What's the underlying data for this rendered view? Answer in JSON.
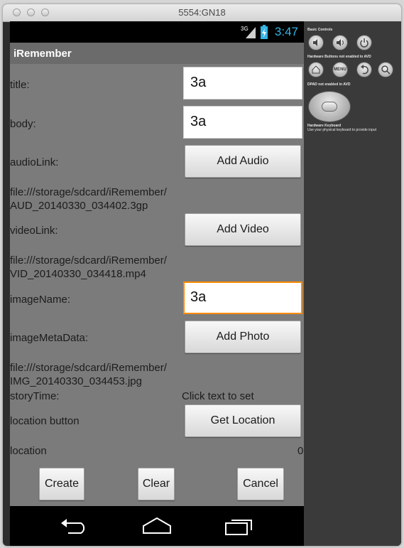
{
  "window": {
    "title": "5554:GN18"
  },
  "status_bar": {
    "network": "3G",
    "time": "3:47"
  },
  "app": {
    "title": "iRemember"
  },
  "form": {
    "title_label": "title:",
    "title_value": "3a",
    "body_label": "body:",
    "body_value": "3a",
    "audio_label": "audioLink:",
    "audio_button": "Add Audio",
    "audio_path_line1": "file:///storage/sdcard/iRemember/",
    "audio_path_line2": "AUD_20140330_034402.3gp",
    "video_label": "videoLink:",
    "video_button": "Add Video",
    "video_path_line1": "file:///storage/sdcard/iRemember/",
    "video_path_line2": "VID_20140330_034418.mp4",
    "image_name_label": "imageName:",
    "image_name_value": "3a",
    "image_meta_label": "imageMetaData:",
    "photo_button": "Add Photo",
    "image_path_line1": "file:///storage/sdcard/iRemember/",
    "image_path_line2": "IMG_20140330_034453.jpg",
    "story_time_label": "storyTime:",
    "story_time_value": "Click text to set",
    "location_button_label": "location button",
    "location_button": "Get Location",
    "location_label": "location",
    "location_value": "0"
  },
  "actions": {
    "create": "Create",
    "clear": "Clear",
    "cancel": "Cancel"
  },
  "controls_panel": {
    "basic_controls": "Basic Controls",
    "hardware_buttons": "Hardware Buttons not enabled in AVD",
    "dpad": "DPAD not enabled in AVD",
    "hardware_keyboard": "Hardware Keyboard",
    "keyboard_hint": "Use your physical keyboard to provide input",
    "menu_label": "MENU"
  },
  "icons": [
    "volume-down-icon",
    "volume-up-icon",
    "power-icon",
    "home-icon",
    "back-icon",
    "search-icon",
    "recent-apps-icon",
    "battery-icon",
    "signal-icon"
  ],
  "colors": {
    "accent": "#33b5e5",
    "focus": "#ff8a00",
    "screen_bg": "#7b7b7b"
  }
}
